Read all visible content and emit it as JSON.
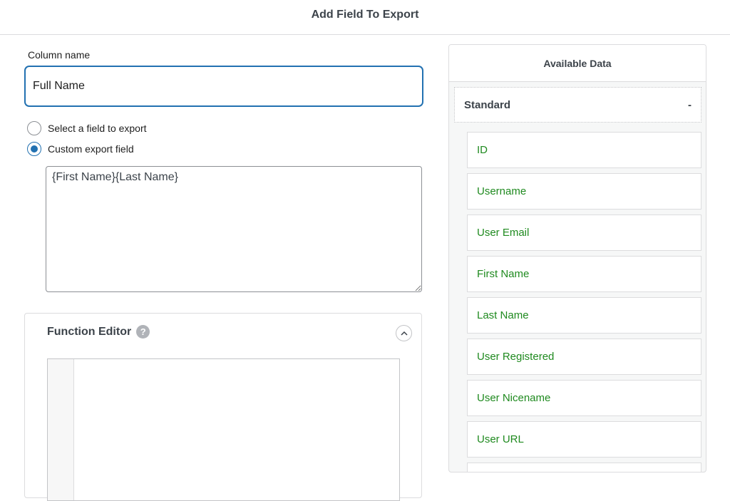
{
  "dialog": {
    "title": "Add Field To Export"
  },
  "column": {
    "label": "Column name",
    "value": "Full Name"
  },
  "options": {
    "select_field_label": "Select a field to export",
    "custom_field_label": "Custom export field",
    "selected": "custom"
  },
  "custom_field": {
    "value": "{First Name}{Last Name}"
  },
  "function_editor": {
    "title": "Function Editor",
    "help_glyph": "?"
  },
  "available": {
    "title": "Available Data",
    "section": {
      "label": "Standard",
      "toggle": "-"
    },
    "fields": [
      "ID",
      "Username",
      "User Email",
      "First Name",
      "Last Name",
      "User Registered",
      "User Nicename",
      "User URL"
    ]
  },
  "colors": {
    "accent": "#2271b1",
    "field_text": "#1f8a1f"
  },
  "icons": {
    "help": "help-icon",
    "collapse": "chevron-up-icon"
  }
}
